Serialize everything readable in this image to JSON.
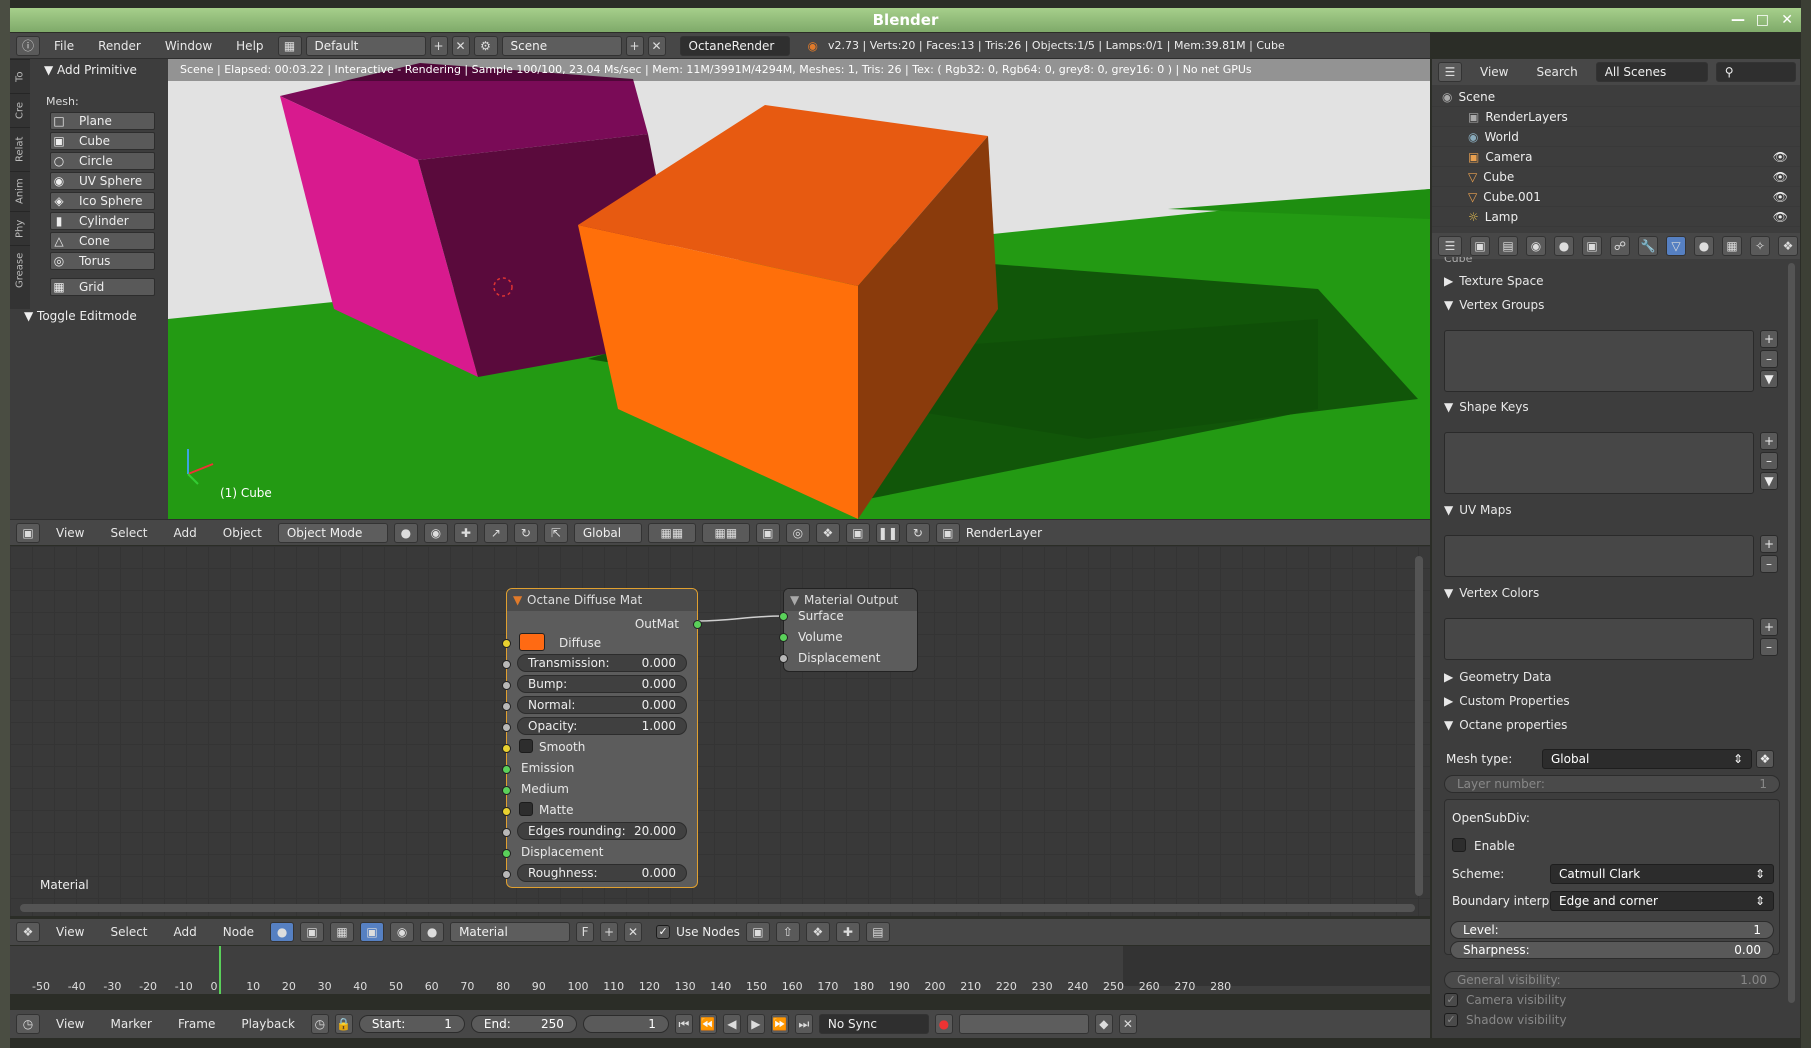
{
  "window": {
    "title": "Blender"
  },
  "menubar": {
    "file": "File",
    "render": "Render",
    "window": "Window",
    "help": "Help",
    "layout": "Default",
    "scene": "Scene",
    "engine": "OctaneRender",
    "stats": "v2.73 | Verts:20 | Faces:13 | Tris:26 | Objects:1/5 | Lamps:0/1 | Mem:39.81M | Cube"
  },
  "toolshelf": {
    "tabs": [
      "To",
      "Cre",
      "Relat",
      "Anim",
      "Phy",
      "Grease"
    ],
    "section": "Add Primitive",
    "mesh_label": "Mesh:",
    "items": [
      "Plane",
      "Cube",
      "Circle",
      "UV Sphere",
      "Ico Sphere",
      "Cylinder",
      "Cone",
      "Torus",
      "Grid"
    ],
    "toggle": "Toggle Editmode"
  },
  "viewport": {
    "info": "Scene | Elapsed: 00:03.22 | Interactive - Rendering | Sample 100/100, 23.04 Ms/sec | Mem: 11M/3991M/4294M, Meshes: 1, Tris: 26 | Tex: ( Rgb32: 0, Rgb64: 0, grey8: 0, grey16: 0 ) | No net GPUs",
    "object_label": "(1) Cube"
  },
  "header3d": {
    "view": "View",
    "select": "Select",
    "add": "Add",
    "object": "Object",
    "mode": "Object Mode",
    "orientation": "Global",
    "render_layer": "RenderLayer"
  },
  "node_editor": {
    "material_label": "Material",
    "diffuse_node": {
      "title": "Octane Diffuse Mat",
      "output": "OutMat",
      "diffuse": "Diffuse",
      "diffuse_color": "#ff6a13",
      "fields": [
        {
          "label": "Transmission:",
          "value": "0.000"
        },
        {
          "label": "Bump:",
          "value": "0.000"
        },
        {
          "label": "Normal:",
          "value": "0.000"
        },
        {
          "label": "Opacity:",
          "value": "1.000"
        }
      ],
      "smooth": "Smooth",
      "emission": "Emission",
      "medium": "Medium",
      "matte": "Matte",
      "edges": {
        "label": "Edges rounding:",
        "value": "20.000"
      },
      "displacement": "Displacement",
      "roughness": {
        "label": "Roughness:",
        "value": "0.000"
      }
    },
    "output_node": {
      "title": "Material Output",
      "inputs": [
        "Surface",
        "Volume",
        "Displacement"
      ]
    }
  },
  "node_header": {
    "view": "View",
    "select": "Select",
    "add": "Add",
    "node": "Node",
    "material": "Material",
    "fake": "F",
    "use_nodes": "Use Nodes"
  },
  "timeline": {
    "ticks": [
      "-50",
      "-40",
      "-30",
      "-20",
      "-10",
      "0",
      "10",
      "20",
      "30",
      "40",
      "50",
      "60",
      "70",
      "80",
      "90",
      "100",
      "110",
      "120",
      "130",
      "140",
      "150",
      "160",
      "170",
      "180",
      "190",
      "200",
      "210",
      "220",
      "230",
      "240",
      "250",
      "260",
      "270",
      "280"
    ],
    "current_frame": 0
  },
  "timeline_header": {
    "view": "View",
    "marker": "Marker",
    "frame": "Frame",
    "playback": "Playback",
    "start_label": "Start:",
    "start": "1",
    "end_label": "End:",
    "end": "250",
    "current": "1",
    "sync": "No Sync"
  },
  "outliner": {
    "view": "View",
    "search": "Search",
    "filter": "All Scenes",
    "rows": [
      "Scene",
      "RenderLayers",
      "World",
      "Camera",
      "Cube",
      "Cube.001",
      "Lamp"
    ]
  },
  "properties": {
    "partial_top": "Cube",
    "texture_space": "Texture Space",
    "vertex_groups": "Vertex Groups",
    "shape_keys": "Shape Keys",
    "uv_maps": "UV Maps",
    "vertex_colors": "Vertex Colors",
    "geometry_data": "Geometry Data",
    "custom_properties": "Custom Properties",
    "octane": "Octane properties",
    "mesh_type_label": "Mesh type:",
    "mesh_type": "Global",
    "layer_number_label": "Layer number:",
    "layer_number": "1",
    "opensubdiv": "OpenSubDiv:",
    "enable": "Enable",
    "scheme_label": "Scheme:",
    "scheme": "Catmull Clark",
    "boundary_label": "Boundary interp.:",
    "boundary": "Edge and corner",
    "level_label": "Level:",
    "level": "1",
    "sharpness_label": "Sharpness:",
    "sharpness": "0.00",
    "gen_vis_label": "General visibility:",
    "gen_vis": "1.00",
    "camera_vis": "Camera visibility",
    "shadow_vis": "Shadow visibility"
  }
}
